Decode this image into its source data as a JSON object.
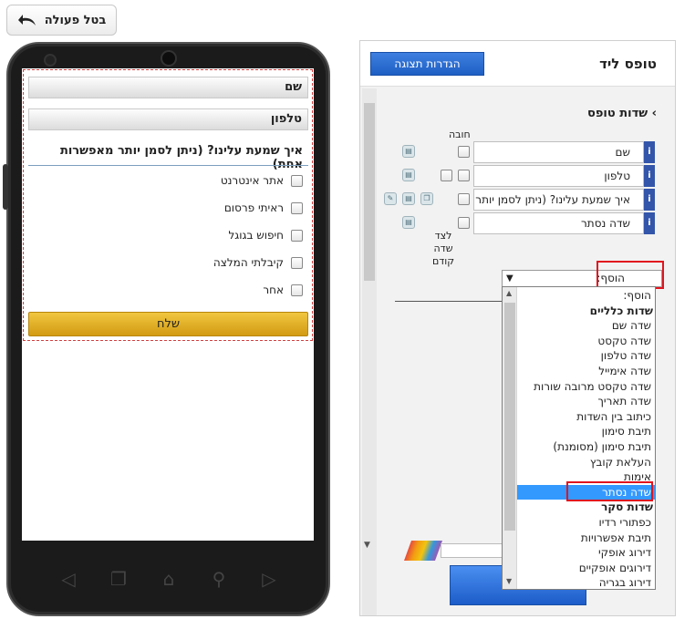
{
  "undo": {
    "label": "בטל פעולה",
    "icon": "undo-arrow-icon"
  },
  "preview": {
    "fields": [
      "שם",
      "טלפון"
    ],
    "question": "איך שמעת עלינו? (ניתן לסמן יותר מאפשרות אחת)",
    "options": [
      "אתר אינטרנט",
      "ראיתי פרסום",
      "חיפוש בגוגל",
      "קיבלתי המלצה",
      "אחר"
    ],
    "submit_label": "שלח",
    "nav_icons": [
      "back-icon",
      "recent-apps-icon",
      "home-icon",
      "search-icon",
      "forward-icon"
    ]
  },
  "panel": {
    "title": "טופס ליד",
    "display_settings_label": "הגדרות תצוגה",
    "section_title": "שדות טופס",
    "section_chevron": "›",
    "required_label": "חובה",
    "side_label_lines": [
      "לצד",
      "שדה",
      "קודם"
    ],
    "info_glyph": "i",
    "rows": [
      {
        "value": "שם"
      },
      {
        "value": "טלפון"
      },
      {
        "value": "איך שמעת עלינו? (ניתן לסמן יותר"
      },
      {
        "value": "שדה נסתר"
      }
    ],
    "add_select": {
      "value": "הוסף:",
      "arrow": "▼"
    }
  },
  "dropdown": {
    "items": [
      {
        "label": "הוסף:",
        "type": "item"
      },
      {
        "label": "שדות כלליים",
        "type": "group"
      },
      {
        "label": "שדה שם",
        "type": "item"
      },
      {
        "label": "שדה טקסט",
        "type": "item"
      },
      {
        "label": "שדה טלפון",
        "type": "item"
      },
      {
        "label": "שדה אימייל",
        "type": "item"
      },
      {
        "label": "שדה טקסט מרובה שורות",
        "type": "item"
      },
      {
        "label": "שדה תאריך",
        "type": "item"
      },
      {
        "label": "כיתוב בין השדות",
        "type": "item"
      },
      {
        "label": "תיבת סימון",
        "type": "item"
      },
      {
        "label": "תיבת סימון (מסומנת)",
        "type": "item"
      },
      {
        "label": "העלאת קובץ",
        "type": "item"
      },
      {
        "label": "אימות",
        "type": "item"
      },
      {
        "label": "שדה נסתר",
        "type": "selected"
      },
      {
        "label": "שדות סקר",
        "type": "group"
      },
      {
        "label": "כפתורי רדיו",
        "type": "item"
      },
      {
        "label": "תיבת אפשרויות",
        "type": "item"
      },
      {
        "label": "דירוג אופקי",
        "type": "item"
      },
      {
        "label": "דירוגים אופקיים",
        "type": "item"
      },
      {
        "label": "דירוג בגריה",
        "type": "item"
      }
    ]
  },
  "colors": {
    "accent_blue": "#1e5fc4",
    "highlight_red": "#e0141e",
    "submit_gold": "#e0ab20",
    "selected_blue": "#3399ff"
  }
}
